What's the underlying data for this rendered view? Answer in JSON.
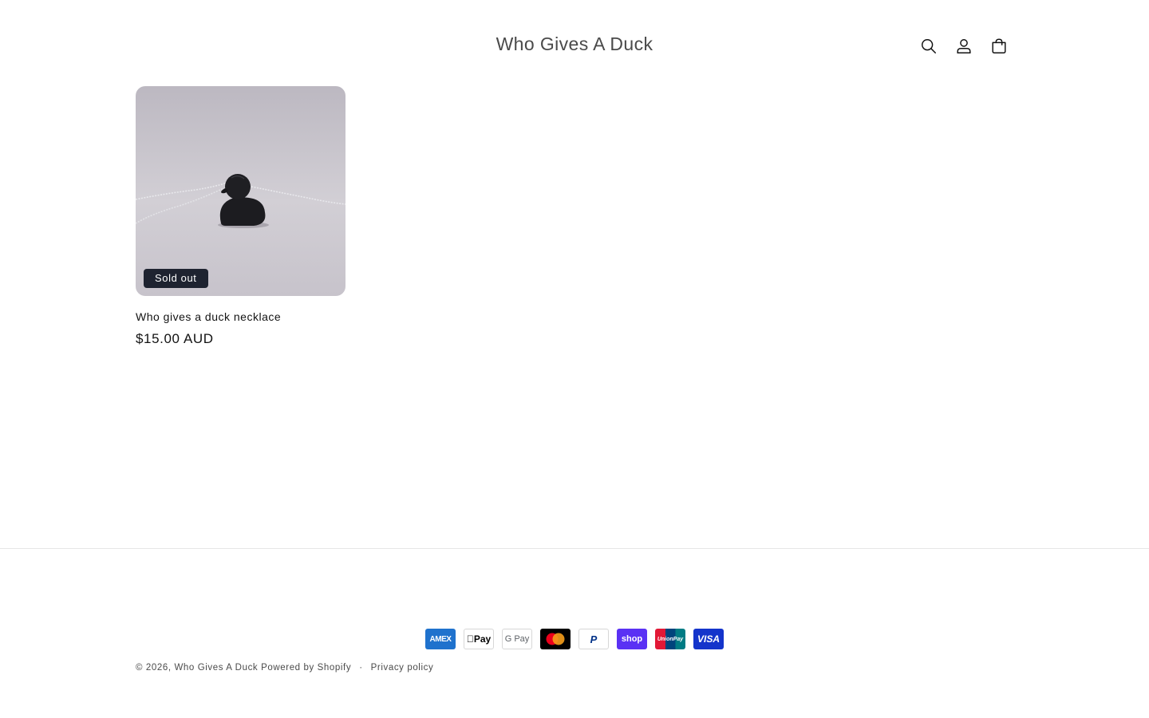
{
  "header": {
    "store_name": "Who Gives A Duck",
    "icons": [
      "search-icon",
      "account-icon",
      "cart-icon"
    ]
  },
  "product": {
    "badge": "Sold out",
    "title": "Who gives a duck necklace",
    "price": "$15.00 AUD"
  },
  "footer": {
    "payment_methods": [
      {
        "name": "American Express",
        "label": "AMEX",
        "color": "#1f72cd"
      },
      {
        "name": "Apple Pay",
        "label": "Pay",
        "color": "#000000"
      },
      {
        "name": "Google Pay",
        "label": "G Pay",
        "color": "#5f6368"
      },
      {
        "name": "Mastercard",
        "label": "",
        "color": "#000000"
      },
      {
        "name": "PayPal",
        "label": "P",
        "color": "#003087"
      },
      {
        "name": "Shop Pay",
        "label": "shop",
        "color": "#5a31f4"
      },
      {
        "name": "UnionPay",
        "label": "UnionPay",
        "color": "#e21836"
      },
      {
        "name": "Visa",
        "label": "VISA",
        "color": "#1a1f71"
      }
    ],
    "copyright_prefix": "© 2026,",
    "copyright_store": "Who Gives A Duck",
    "powered_by": "Powered by Shopify",
    "separator": "·",
    "privacy_policy": "Privacy policy"
  }
}
